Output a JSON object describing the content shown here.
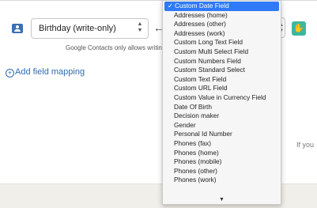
{
  "mapping": {
    "field_value": "Birthday (write-only)",
    "arrow": "←",
    "helper_text": "Google Contacts only allows writing"
  },
  "add_mapping_label": "Add field mapping",
  "side_note": "If you",
  "dropdown": {
    "check": "✓",
    "options": [
      "Custom Date Field",
      "Addresses (home)",
      "Addresses (other)",
      "Addresses (work)",
      "Custom Long Text Field",
      "Custom Multi Select Field",
      "Custom Numbers Field",
      "Custom Standard Select",
      "Custom Text Field",
      "Custom URL Field",
      "Custom Value in Currency Field",
      "Date Of Birth",
      "Decision maker",
      "Gender",
      "Personal Id Number",
      "Phones (fax)",
      "Phones (home)",
      "Phones (mobile)",
      "Phones (other)",
      "Phones (work)"
    ],
    "scroll_down_glyph": "▼"
  },
  "colors": {
    "accent": "#2f7af6",
    "link": "#2f6bb3",
    "teal_button": "#3bb8a0",
    "contact_icon": "#3b6fb6"
  }
}
